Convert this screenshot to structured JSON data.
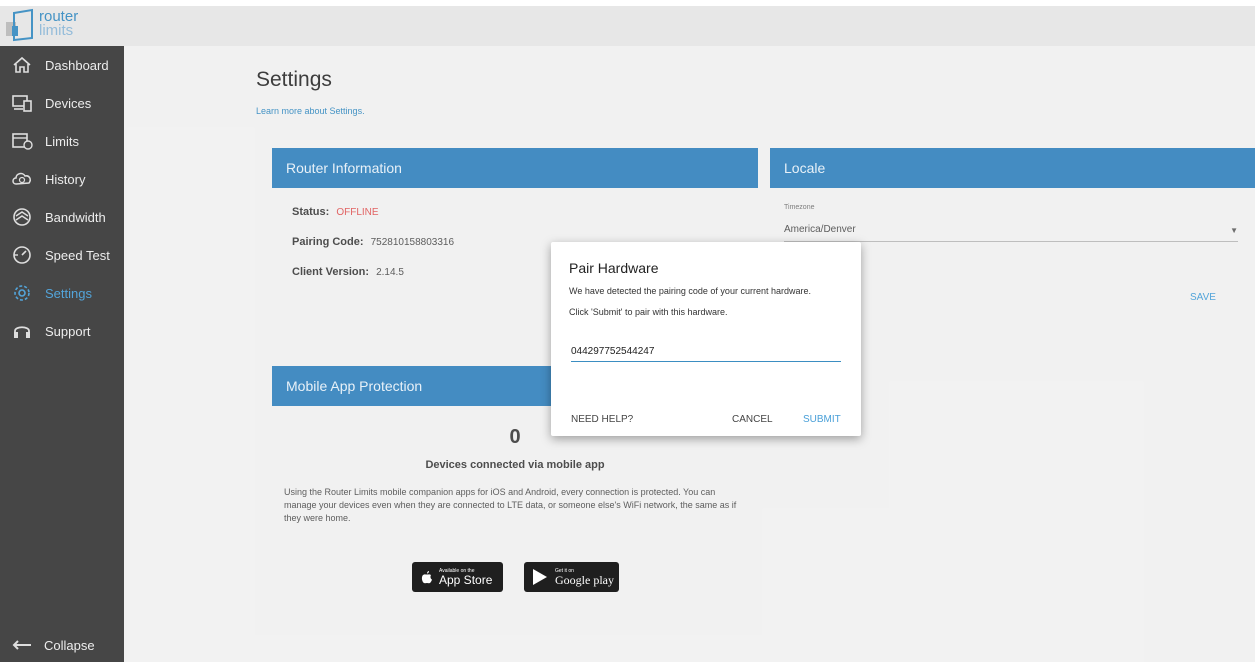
{
  "app": {
    "logo_line1": "router",
    "logo_line2": "limits"
  },
  "sidebar": {
    "items": [
      {
        "label": "Dashboard",
        "icon": "home-icon"
      },
      {
        "label": "Devices",
        "icon": "devices-icon"
      },
      {
        "label": "Limits",
        "icon": "calendar-clock-icon"
      },
      {
        "label": "History",
        "icon": "history-cloud-icon"
      },
      {
        "label": "Bandwidth",
        "icon": "bandwidth-icon"
      },
      {
        "label": "Speed Test",
        "icon": "speedometer-icon"
      },
      {
        "label": "Settings",
        "icon": "gear-icon"
      },
      {
        "label": "Support",
        "icon": "headset-icon"
      }
    ],
    "active": "Settings",
    "collapse_label": "Collapse"
  },
  "page": {
    "title": "Settings",
    "learn_more": "Learn more about Settings."
  },
  "router_info": {
    "header": "Router Information",
    "status_label": "Status:",
    "status_value": "OFFLINE",
    "pairing_label": "Pairing Code:",
    "pairing_value": "752810158803316",
    "client_label": "Client Version:",
    "client_value": "2.14.5"
  },
  "locale": {
    "header": "Locale",
    "timezone_label": "Timezone",
    "timezone_value": "America/Denver",
    "save_label": "SAVE"
  },
  "mobile": {
    "header": "Mobile App Protection",
    "count": "0",
    "count_label": "Devices connected via mobile app",
    "description": "Using the Router Limits mobile companion apps for iOS and Android, every connection is protected. You can manage your devices even when they are connected to LTE data, or someone else's WiFi network, the same as if they were home.",
    "appstore_small": "Available on the",
    "appstore_big": "App Store",
    "gplay_small": "Get it on",
    "gplay_big": "Google play"
  },
  "modal": {
    "title": "Pair Hardware",
    "text1": "We have detected the pairing code of your current hardware.",
    "text2": "Click 'Submit' to pair with this hardware.",
    "input_value": "044297752544247",
    "help_label": "NEED HELP?",
    "cancel_label": "CANCEL",
    "submit_label": "SUBMIT"
  },
  "colors": {
    "accent": "#3a86bf",
    "sidebar_bg": "#3d3d3d",
    "offline": "#e05b5b",
    "link": "#4aa0d8"
  }
}
